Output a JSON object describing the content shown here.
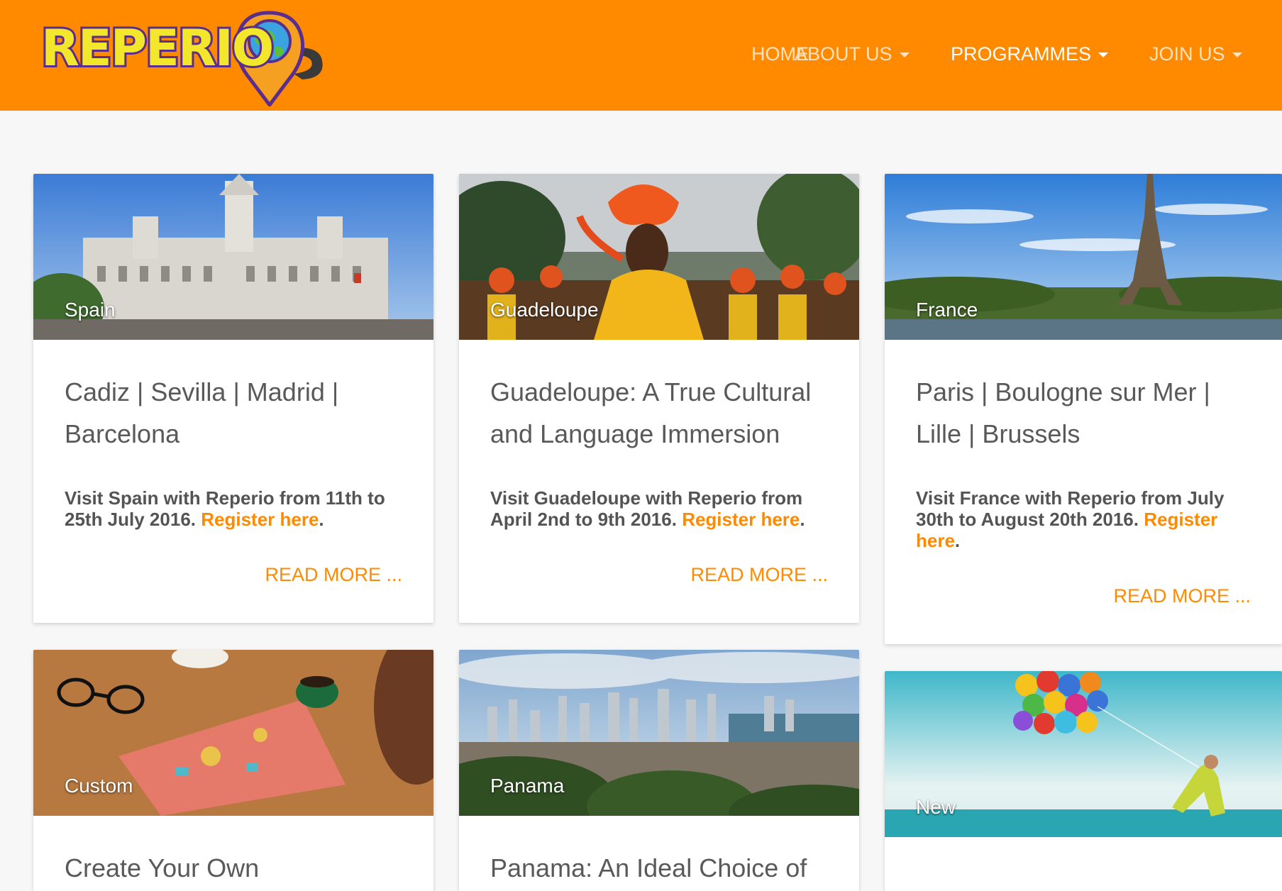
{
  "brand": {
    "name": "REPERIO",
    "primary_color": "#ff8a00",
    "logo_icon": "map-pin-globe-logo"
  },
  "nav": {
    "items": [
      {
        "label": "HOME",
        "dropdown": false,
        "active": false
      },
      {
        "label": "ABOUT US",
        "dropdown": true,
        "active": false
      },
      {
        "label": "PROGRAMMES",
        "dropdown": true,
        "active": true
      },
      {
        "label": "JOIN US",
        "dropdown": true,
        "active": false
      }
    ]
  },
  "cards": [
    {
      "tag": "Spain",
      "image": "madrid-palace-photo",
      "title": "Cadiz | Sevilla | Madrid | Barcelona",
      "text": "Visit Spain with Reperio from 11th  to 25th July 2016.",
      "link": "Register here",
      "after_link": ".",
      "read_more": "READ MORE ..."
    },
    {
      "tag": "Guadeloupe",
      "image": "carnival-dancer-photo",
      "title": "Guadeloupe: A True Cultural and Language Immersion",
      "text": "Visit Guadeloupe with Reperio from April 2nd to 9th 2016.",
      "link": "Register here",
      "after_link": ".",
      "read_more": "READ MORE ..."
    },
    {
      "tag": "France",
      "image": "eiffel-tower-photo",
      "title": "Paris | Boulogne sur Mer | Lille | Brussels",
      "text": "Visit France with Reperio from July 30th to August 20th 2016.",
      "link": "Register here",
      "after_link": ".",
      "read_more": "READ MORE ..."
    },
    {
      "tag": "Custom",
      "image": "desk-laptop-coffee-photo",
      "title": "Create Your Own"
    },
    {
      "tag": "Panama",
      "image": "panama-city-skyline-photo",
      "title": "Panama: An Ideal Choice of"
    },
    {
      "tag": "New",
      "image": "balloons-beach-photo",
      "title": ""
    }
  ]
}
